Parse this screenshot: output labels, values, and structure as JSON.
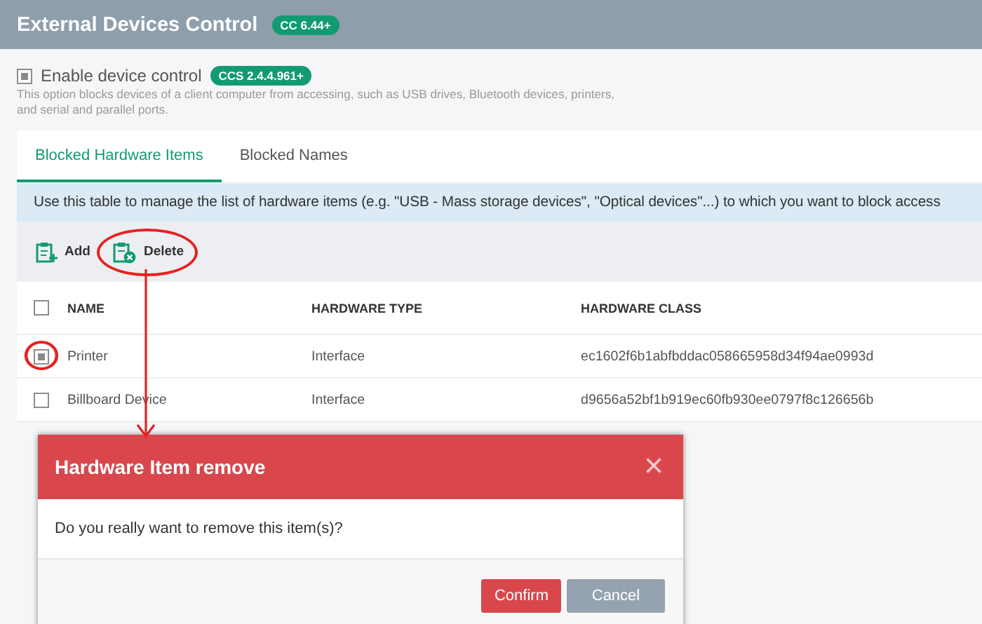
{
  "header": {
    "title": "External Devices Control",
    "badge": "CC 6.44+"
  },
  "device_control": {
    "label": "Enable device control",
    "checked": true,
    "badge": "CCS 2.4.4.961+",
    "description": "This option blocks devices of a client computer from accessing, such as USB drives, Bluetooth devices, printers, and serial and parallel ports."
  },
  "tabs": [
    {
      "label": "Blocked Hardware Items",
      "selected": true
    },
    {
      "label": "Blocked Names",
      "selected": false
    }
  ],
  "info": "Use this table to manage the list of hardware items (e.g. \"USB - Mass storage devices\", \"Optical devices\"...) to which you want to block access",
  "toolbar": [
    {
      "label": "Add",
      "kind": "add",
      "highlighted": false
    },
    {
      "label": "Delete",
      "kind": "delete",
      "highlighted": true
    }
  ],
  "table": {
    "select_all_checked": false,
    "columns": [
      "NAME",
      "HARDWARE TYPE",
      "HARDWARE CLASS"
    ],
    "rows": [
      {
        "checked": true,
        "highlighted": true,
        "cells": [
          "Printer",
          "Interface",
          "ec1602f6b1abfbddac058665958d34f94ae0993d"
        ]
      },
      {
        "checked": false,
        "highlighted": false,
        "cells": [
          "Billboard Device",
          "Interface",
          "d9656a52bf1b919ec60fb930ee0797f8c126656b"
        ]
      }
    ]
  },
  "dialog": {
    "title": "Hardware Item remove",
    "close": "×",
    "message": "Do you really want to remove this item(s)?",
    "buttons": [
      {
        "label": "Confirm",
        "kind": "primary"
      },
      {
        "label": "Cancel",
        "kind": "secondary"
      }
    ]
  }
}
